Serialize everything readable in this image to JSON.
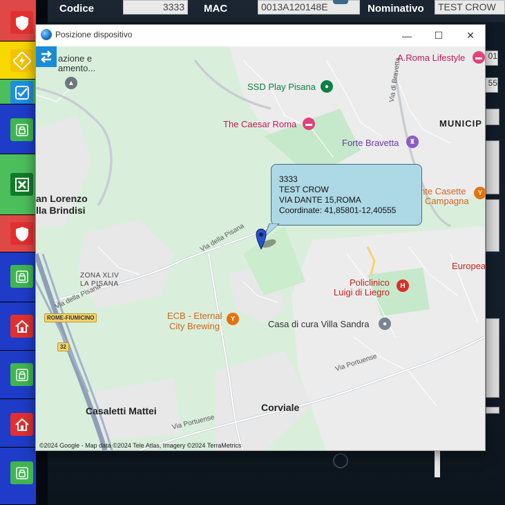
{
  "background_app": {
    "codice_label": "Codice",
    "codice_value": "3333",
    "mac_label": "MAC",
    "mac_value": "0013A120148E",
    "nominativo_label": "Nominativo",
    "nominativo_value": "TEST CROW",
    "right_field_1": "01",
    "right_field_2": "55"
  },
  "dialog": {
    "title": "Posizione dispositivo",
    "minimize": "—",
    "maximize": "☐",
    "close": "✕"
  },
  "map": {
    "places": {
      "fondazione_1": "azione e",
      "fondazione_2": "amento...",
      "ssd": "SSD Play Pisana",
      "caesar": "The Caesar Roma",
      "aroma": "A.Roma Lifestyle",
      "bravetta_street": "Via di Bravetta",
      "municip": "MUNICIP",
      "forte": "Forte Bravetta",
      "lorenzo_1": "an Lorenzo",
      "lorenzo_2": "lla Brindisi",
      "casette_1": "nte Casette",
      "casette_2": "Campagna",
      "pisana_street": "Via della Pisana",
      "pisana_street_2": "Via della Pisana",
      "zona_1": "ZONA XLIV",
      "zona_2": "LA PISANA",
      "europea": "Europea",
      "policlinico_1": "Policlinico",
      "policlinico_2": "Luigi di Liegro",
      "fiumicino": "ROME-FIUMICINO",
      "ecb_1": "ECB - Eternal",
      "ecb_2": "City Brewing",
      "villa_sandra": "Casa di cura Villa Sandra",
      "portuense_1": "Via Portuense",
      "shield_32": "32",
      "casaletti": "Casaletti Mattei",
      "portuense_2": "Via Portuense",
      "corviale": "Corviale"
    },
    "callout": {
      "line1": "3333",
      "line2": "TEST CROW",
      "line3": "VIA DANTE 15,ROMA",
      "line4": "Coordinate:  41,85801-12,40555"
    },
    "copyright": "©2024 Google - Map data ©2024 Tele Atlas, Imagery ©2024 TerraMetrics"
  },
  "colors": {
    "map_green": "#d9efdc",
    "callout_bg": "#add8e6",
    "accent_blue": "#1a8bd8"
  }
}
